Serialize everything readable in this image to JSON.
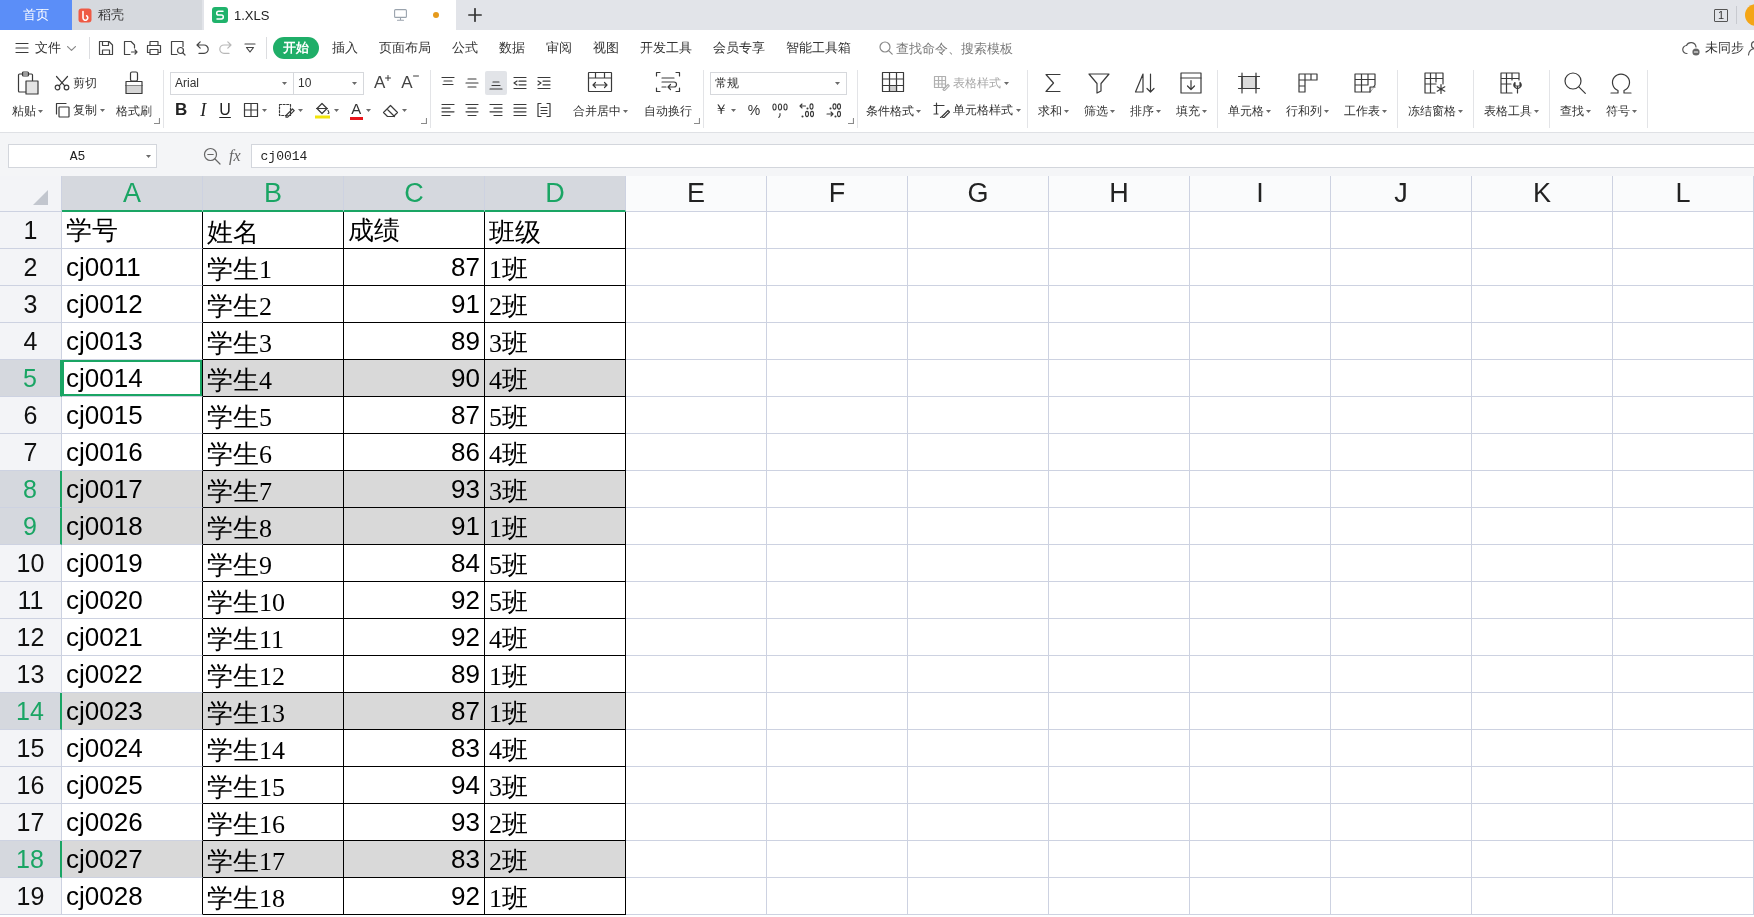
{
  "tab_bar": {
    "tabs": [
      {
        "kind": "home",
        "label": "首页",
        "selected": false
      },
      {
        "kind": "app",
        "label": "稻壳",
        "selected": false
      },
      {
        "kind": "document",
        "label": "1.XLS",
        "selected": true,
        "unsaved": true
      }
    ],
    "window_count": "1"
  },
  "menu_bar": {
    "file_menu": "文件",
    "quick_access": [
      {
        "kind": "save",
        "disabled": false
      },
      {
        "kind": "export",
        "disabled": false
      },
      {
        "kind": "print",
        "disabled": false
      },
      {
        "kind": "preview",
        "disabled": false
      },
      {
        "kind": "undo",
        "disabled": false
      },
      {
        "kind": "redo",
        "disabled": true
      },
      {
        "kind": "customize",
        "disabled": false
      }
    ],
    "tabs": [
      {
        "label": "开始",
        "selected": true
      },
      {
        "label": "插入",
        "selected": false
      },
      {
        "label": "页面布局",
        "selected": false
      },
      {
        "label": "公式",
        "selected": false
      },
      {
        "label": "数据",
        "selected": false
      },
      {
        "label": "审阅",
        "selected": false
      },
      {
        "label": "视图",
        "selected": false
      },
      {
        "label": "开发工具",
        "selected": false
      },
      {
        "label": "会员专享",
        "selected": false
      },
      {
        "label": "智能工具箱",
        "selected": false
      }
    ],
    "search": {
      "placeholder": "查找命令、搜索模板"
    },
    "sync_status": "未同步"
  },
  "ribbon": {
    "clipboard": {
      "paste": "粘贴",
      "cut": "剪切",
      "copy": "复制",
      "format_painter": "格式刷"
    },
    "font": {
      "name": "Arial",
      "size": "10",
      "size_buttons": [
        {
          "kind": "grow",
          "label": "A"
        },
        {
          "kind": "shrink",
          "label": "A"
        }
      ],
      "style_buttons": [
        {
          "kind": "bold",
          "label": "B"
        },
        {
          "kind": "italic",
          "label": "I"
        },
        {
          "kind": "underline",
          "label": "U"
        }
      ],
      "font_color": "A"
    },
    "alignment": {
      "buttons": [
        {
          "kind": "top",
          "on": false
        },
        {
          "kind": "middle",
          "on": false
        },
        {
          "kind": "bottom",
          "on": true
        },
        {
          "kind": "indent-decrease",
          "on": false
        },
        {
          "kind": "indent-increase",
          "on": false
        },
        {
          "kind": "left",
          "on": false
        },
        {
          "kind": "center",
          "on": false
        },
        {
          "kind": "right",
          "on": false
        },
        {
          "kind": "justify",
          "on": false
        },
        {
          "kind": "distributed",
          "on": false
        }
      ],
      "merge": "合并居中",
      "wrap": "自动换行"
    },
    "number": {
      "format": "常规",
      "buttons": [
        {
          "kind": "currency",
          "label": "￥"
        },
        {
          "kind": "percent",
          "label": "%"
        },
        {
          "kind": "thousands"
        },
        {
          "kind": "decimal-increase"
        },
        {
          "kind": "decimal-decrease"
        }
      ]
    },
    "styles": {
      "conditional_format": "条件格式",
      "table_style": {
        "label": "表格样式",
        "disabled": true
      },
      "cell_style": "单元格样式"
    },
    "tool_groups": [
      [
        {
          "kind": "sum",
          "label": "求和"
        },
        {
          "kind": "filter",
          "label": "筛选"
        },
        {
          "kind": "sort",
          "label": "排序"
        },
        {
          "kind": "fill",
          "label": "填充"
        }
      ],
      [
        {
          "kind": "cell",
          "label": "单元格"
        },
        {
          "kind": "rows-columns",
          "label": "行和列"
        },
        {
          "kind": "worksheet",
          "label": "工作表"
        }
      ],
      [
        {
          "kind": "freeze",
          "label": "冻结窗格"
        }
      ],
      [
        {
          "kind": "table-tools",
          "label": "表格工具"
        }
      ],
      [
        {
          "kind": "find",
          "label": "查找"
        },
        {
          "kind": "symbol",
          "label": "符号"
        }
      ]
    ]
  },
  "formula_bar": {
    "name_box": "A5",
    "function_label": "fx",
    "formula": "cj0014"
  },
  "table": {
    "columns": [
      {
        "label": "A",
        "selected": true,
        "bordered": false
      },
      {
        "label": "B",
        "selected": true,
        "bordered": true
      },
      {
        "label": "C",
        "selected": true,
        "bordered": true
      },
      {
        "label": "D",
        "selected": true,
        "bordered": true
      },
      {
        "label": "E",
        "selected": false,
        "bordered": false
      },
      {
        "label": "F",
        "selected": false,
        "bordered": false
      },
      {
        "label": "G",
        "selected": false,
        "bordered": false
      },
      {
        "label": "H",
        "selected": false,
        "bordered": false
      },
      {
        "label": "I",
        "selected": false,
        "bordered": false
      },
      {
        "label": "J",
        "selected": false,
        "bordered": false
      },
      {
        "label": "K",
        "selected": false,
        "bordered": false
      },
      {
        "label": "L",
        "selected": false,
        "bordered": false
      }
    ],
    "rows": [
      {
        "header": "1",
        "selected": false,
        "cells": [
          {
            "text": "学号",
            "kind": "text",
            "active": false
          },
          {
            "text": "姓名",
            "kind": "text",
            "active": false
          },
          {
            "text": "成绩",
            "kind": "text",
            "active": false
          },
          {
            "text": "班级",
            "kind": "text",
            "active": false
          }
        ]
      },
      {
        "header": "2",
        "selected": false,
        "cells": [
          {
            "text": "cj0011",
            "kind": "text",
            "active": false
          },
          {
            "text": "学生1",
            "kind": "text",
            "active": false
          },
          {
            "text": "87",
            "kind": "number",
            "active": false
          },
          {
            "text": "1班",
            "kind": "text",
            "active": false
          }
        ]
      },
      {
        "header": "3",
        "selected": false,
        "cells": [
          {
            "text": "cj0012",
            "kind": "text",
            "active": false
          },
          {
            "text": "学生2",
            "kind": "text",
            "active": false
          },
          {
            "text": "91",
            "kind": "number",
            "active": false
          },
          {
            "text": "2班",
            "kind": "text",
            "active": false
          }
        ]
      },
      {
        "header": "4",
        "selected": false,
        "cells": [
          {
            "text": "cj0013",
            "kind": "text",
            "active": false
          },
          {
            "text": "学生3",
            "kind": "text",
            "active": false
          },
          {
            "text": "89",
            "kind": "number",
            "active": false
          },
          {
            "text": "3班",
            "kind": "text",
            "active": false
          }
        ]
      },
      {
        "header": "5",
        "selected": true,
        "cells": [
          {
            "text": "cj0014",
            "kind": "text",
            "active": true
          },
          {
            "text": "学生4",
            "kind": "text",
            "active": false
          },
          {
            "text": "90",
            "kind": "number",
            "active": false
          },
          {
            "text": "4班",
            "kind": "text",
            "active": false
          }
        ]
      },
      {
        "header": "6",
        "selected": false,
        "cells": [
          {
            "text": "cj0015",
            "kind": "text",
            "active": false
          },
          {
            "text": "学生5",
            "kind": "text",
            "active": false
          },
          {
            "text": "87",
            "kind": "number",
            "active": false
          },
          {
            "text": "5班",
            "kind": "text",
            "active": false
          }
        ]
      },
      {
        "header": "7",
        "selected": false,
        "cells": [
          {
            "text": "cj0016",
            "kind": "text",
            "active": false
          },
          {
            "text": "学生6",
            "kind": "text",
            "active": false
          },
          {
            "text": "86",
            "kind": "number",
            "active": false
          },
          {
            "text": "4班",
            "kind": "text",
            "active": false
          }
        ]
      },
      {
        "header": "8",
        "selected": true,
        "cells": [
          {
            "text": "cj0017",
            "kind": "text",
            "active": false
          },
          {
            "text": "学生7",
            "kind": "text",
            "active": false
          },
          {
            "text": "93",
            "kind": "number",
            "active": false
          },
          {
            "text": "3班",
            "kind": "text",
            "active": false
          }
        ]
      },
      {
        "header": "9",
        "selected": true,
        "cells": [
          {
            "text": "cj0018",
            "kind": "text",
            "active": false
          },
          {
            "text": "学生8",
            "kind": "text",
            "active": false
          },
          {
            "text": "91",
            "kind": "number",
            "active": false
          },
          {
            "text": "1班",
            "kind": "text",
            "active": false
          }
        ]
      },
      {
        "header": "10",
        "selected": false,
        "cells": [
          {
            "text": "cj0019",
            "kind": "text",
            "active": false
          },
          {
            "text": "学生9",
            "kind": "text",
            "active": false
          },
          {
            "text": "84",
            "kind": "number",
            "active": false
          },
          {
            "text": "5班",
            "kind": "text",
            "active": false
          }
        ]
      },
      {
        "header": "11",
        "selected": false,
        "cells": [
          {
            "text": "cj0020",
            "kind": "text",
            "active": false
          },
          {
            "text": "学生10",
            "kind": "text",
            "active": false
          },
          {
            "text": "92",
            "kind": "number",
            "active": false
          },
          {
            "text": "5班",
            "kind": "text",
            "active": false
          }
        ]
      },
      {
        "header": "12",
        "selected": false,
        "cells": [
          {
            "text": "cj0021",
            "kind": "text",
            "active": false
          },
          {
            "text": "学生11",
            "kind": "text",
            "active": false
          },
          {
            "text": "92",
            "kind": "number",
            "active": false
          },
          {
            "text": "4班",
            "kind": "text",
            "active": false
          }
        ]
      },
      {
        "header": "13",
        "selected": false,
        "cells": [
          {
            "text": "cj0022",
            "kind": "text",
            "active": false
          },
          {
            "text": "学生12",
            "kind": "text",
            "active": false
          },
          {
            "text": "89",
            "kind": "number",
            "active": false
          },
          {
            "text": "1班",
            "kind": "text",
            "active": false
          }
        ]
      },
      {
        "header": "14",
        "selected": true,
        "cells": [
          {
            "text": "cj0023",
            "kind": "text",
            "active": false
          },
          {
            "text": "学生13",
            "kind": "text",
            "active": false
          },
          {
            "text": "87",
            "kind": "number",
            "active": false
          },
          {
            "text": "1班",
            "kind": "text",
            "active": false
          }
        ]
      },
      {
        "header": "15",
        "selected": false,
        "cells": [
          {
            "text": "cj0024",
            "kind": "text",
            "active": false
          },
          {
            "text": "学生14",
            "kind": "text",
            "active": false
          },
          {
            "text": "83",
            "kind": "number",
            "active": false
          },
          {
            "text": "4班",
            "kind": "text",
            "active": false
          }
        ]
      },
      {
        "header": "16",
        "selected": false,
        "cells": [
          {
            "text": "cj0025",
            "kind": "text",
            "active": false
          },
          {
            "text": "学生15",
            "kind": "text",
            "active": false
          },
          {
            "text": "94",
            "kind": "number",
            "active": false
          },
          {
            "text": "3班",
            "kind": "text",
            "active": false
          }
        ]
      },
      {
        "header": "17",
        "selected": false,
        "cells": [
          {
            "text": "cj0026",
            "kind": "text",
            "active": false
          },
          {
            "text": "学生16",
            "kind": "text",
            "active": false
          },
          {
            "text": "93",
            "kind": "number",
            "active": false
          },
          {
            "text": "2班",
            "kind": "text",
            "active": false
          }
        ]
      },
      {
        "header": "18",
        "selected": true,
        "cells": [
          {
            "text": "cj0027",
            "kind": "text",
            "active": false
          },
          {
            "text": "学生17",
            "kind": "text",
            "active": false
          },
          {
            "text": "83",
            "kind": "number",
            "active": false
          },
          {
            "text": "2班",
            "kind": "text",
            "active": false
          }
        ]
      },
      {
        "header": "19",
        "selected": false,
        "cells": [
          {
            "text": "cj0028",
            "kind": "text",
            "active": false
          },
          {
            "text": "学生18",
            "kind": "text",
            "active": false
          },
          {
            "text": "92",
            "kind": "number",
            "active": false
          },
          {
            "text": "1班",
            "kind": "text",
            "active": false
          }
        ]
      }
    ]
  }
}
